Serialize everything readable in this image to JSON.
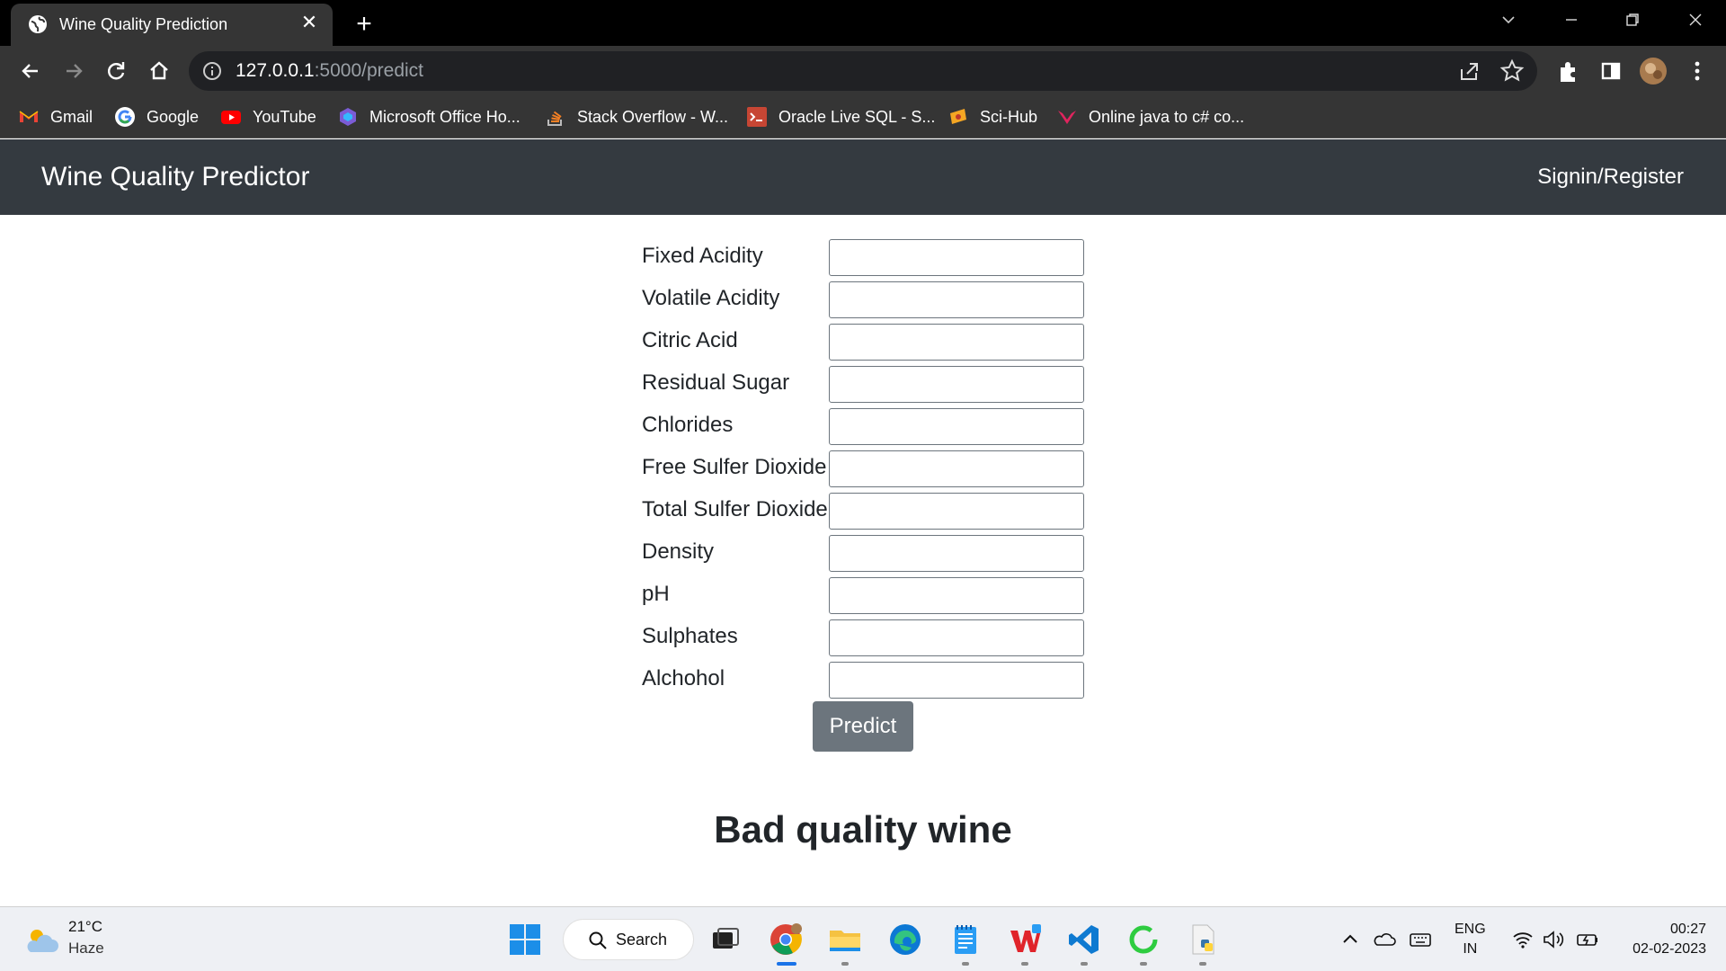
{
  "browser": {
    "tab_title": "Wine Quality Prediction",
    "url_host": "127.0.0.1",
    "url_path": ":5000/predict",
    "bookmarks": [
      {
        "label": "Gmail",
        "icon": "gmail-icon"
      },
      {
        "label": "Google",
        "icon": "google-icon"
      },
      {
        "label": "YouTube",
        "icon": "youtube-icon"
      },
      {
        "label": "Microsoft Office Ho...",
        "icon": "office-icon"
      },
      {
        "label": "Stack Overflow - W...",
        "icon": "stackoverflow-icon"
      },
      {
        "label": "Oracle Live SQL - S...",
        "icon": "oracle-icon"
      },
      {
        "label": "Sci-Hub",
        "icon": "scihub-icon"
      },
      {
        "label": "Online java to c# co...",
        "icon": "converter-icon"
      }
    ]
  },
  "navbar": {
    "brand": "Wine Quality Predictor",
    "signin": "Signin/Register"
  },
  "form": {
    "fields": [
      {
        "label": "Fixed Acidity",
        "value": ""
      },
      {
        "label": "Volatile Acidity",
        "value": ""
      },
      {
        "label": "Citric Acid",
        "value": ""
      },
      {
        "label": "Residual Sugar",
        "value": ""
      },
      {
        "label": "Chlorides",
        "value": ""
      },
      {
        "label": "Free Sulfer Dioxide",
        "value": ""
      },
      {
        "label": "Total Sulfer Dioxide",
        "value": ""
      },
      {
        "label": "Density",
        "value": ""
      },
      {
        "label": "pH",
        "value": ""
      },
      {
        "label": "Sulphates",
        "value": ""
      },
      {
        "label": "Alchohol",
        "value": ""
      }
    ],
    "submit_label": "Predict"
  },
  "result": "Bad quality wine",
  "taskbar": {
    "weather_temp": "21°C",
    "weather_condition": "Haze",
    "search_label": "Search",
    "lang_line1": "ENG",
    "lang_line2": "IN",
    "time": "00:27",
    "date": "02-02-2023"
  }
}
